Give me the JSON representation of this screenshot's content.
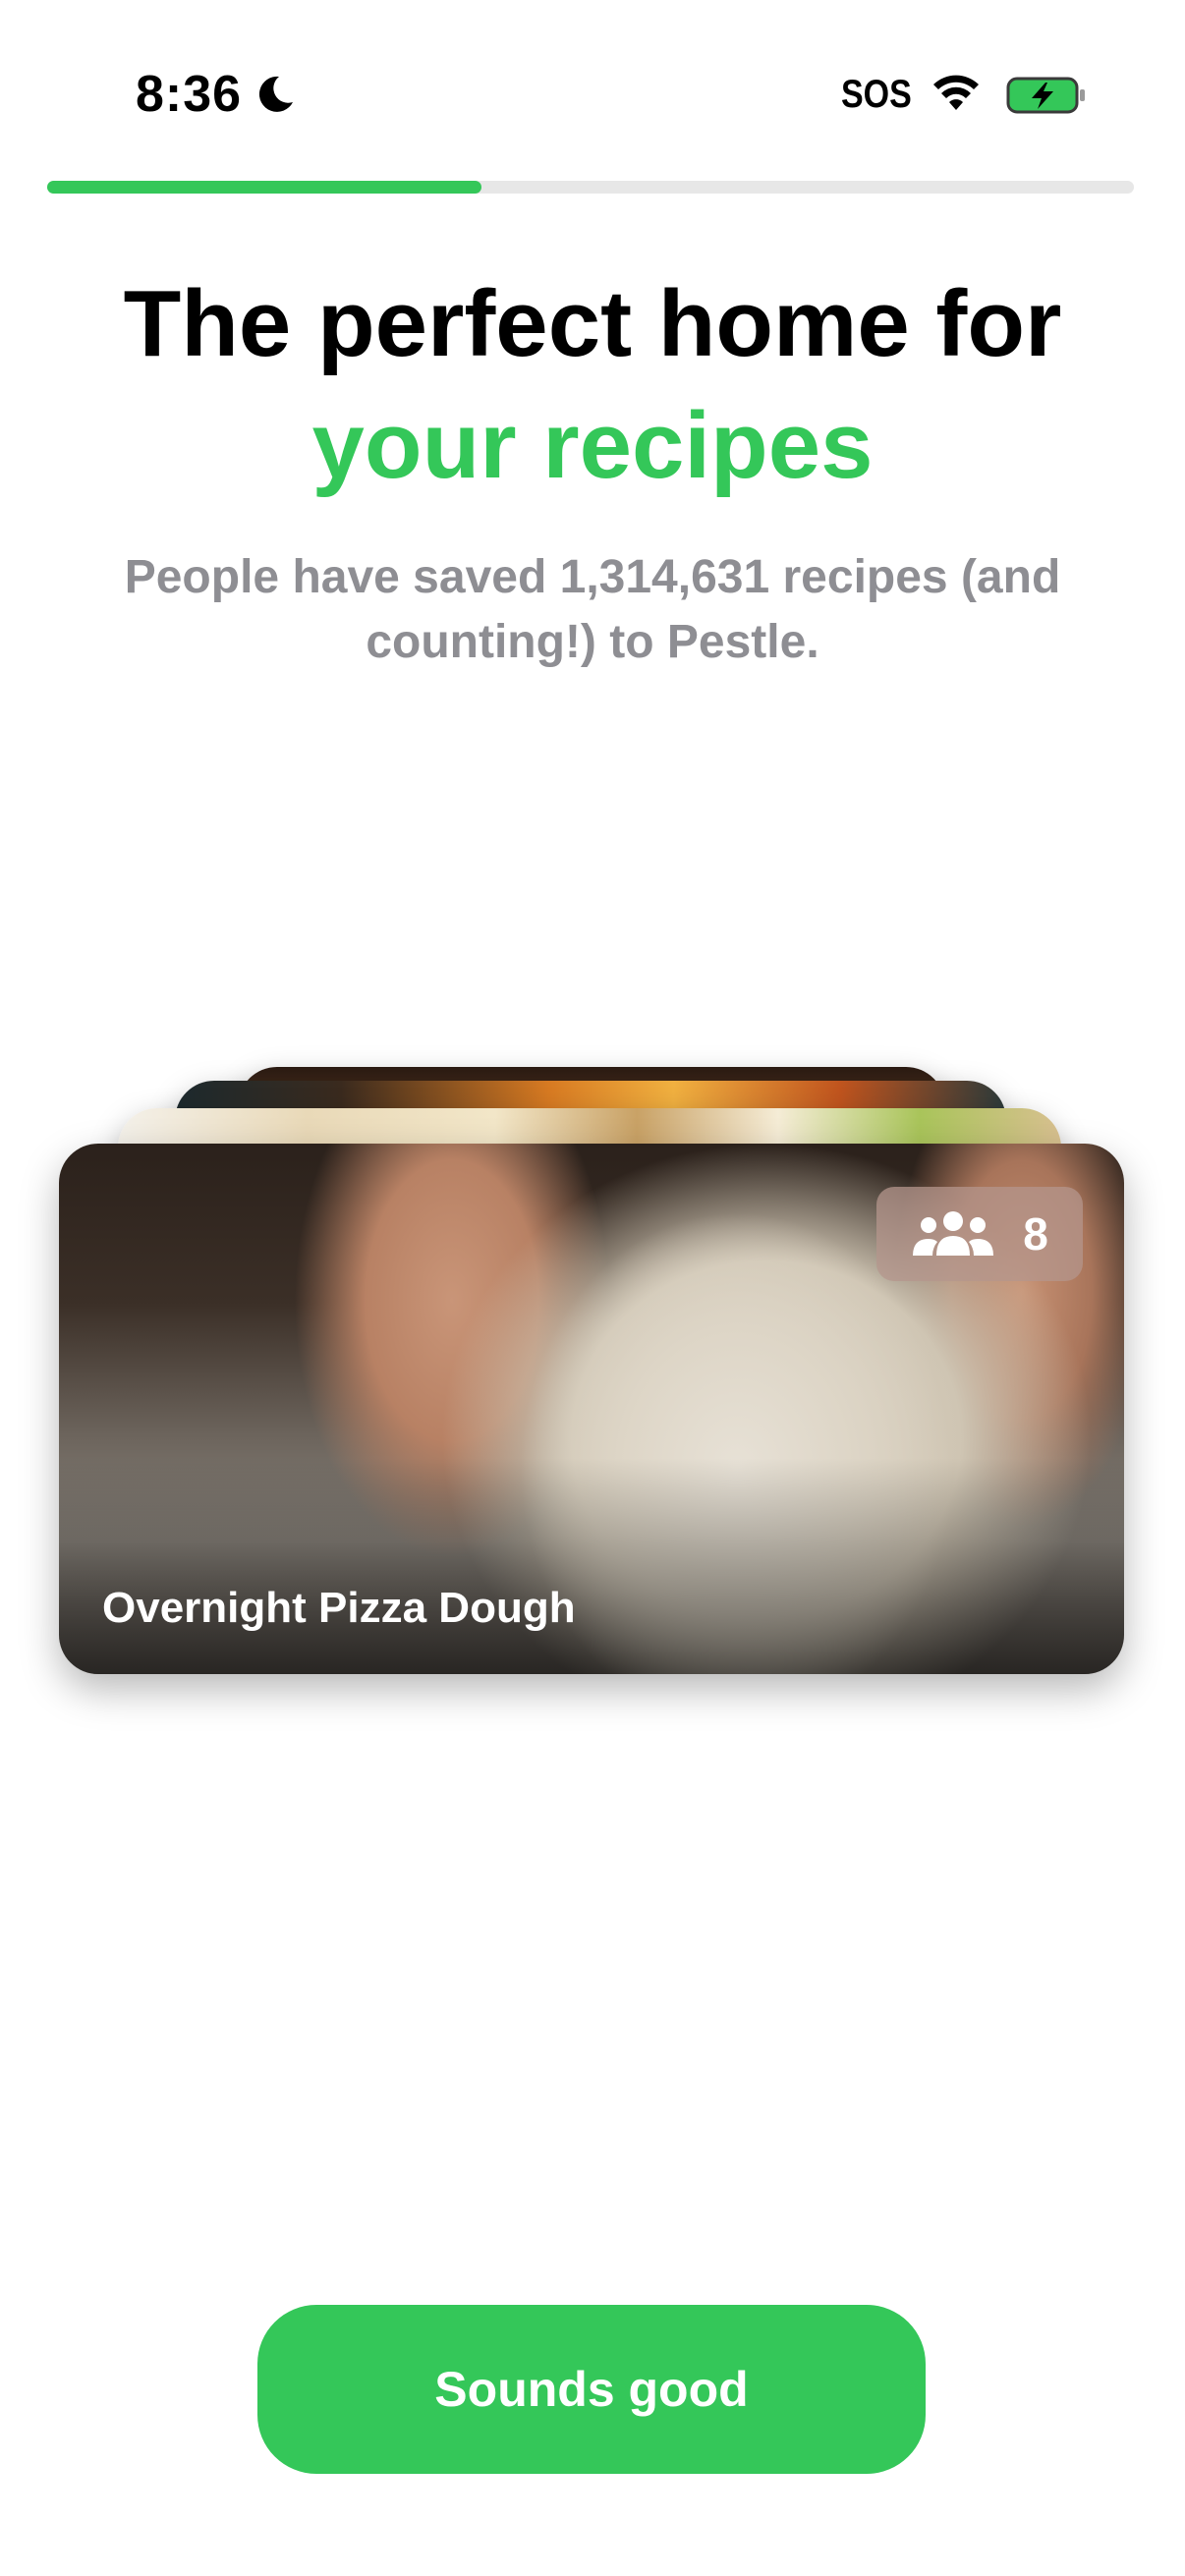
{
  "status_bar": {
    "time": "8:36",
    "carrier": "SOS",
    "icons": [
      "moon-icon",
      "wifi-icon",
      "battery-charging-icon"
    ]
  },
  "progress": {
    "fraction": 0.4
  },
  "heading": {
    "line1": "The perfect home for",
    "line2": "your recipes"
  },
  "subtitle": "People have saved 1,314,631 recipes (and counting!) to Pestle.",
  "card": {
    "title": "Overnight Pizza Dough",
    "servings": "8",
    "servings_icon": "people-icon"
  },
  "cta": {
    "label": "Sounds good"
  },
  "colors": {
    "accent": "#34c759",
    "secondary_text": "#8e8e93"
  }
}
